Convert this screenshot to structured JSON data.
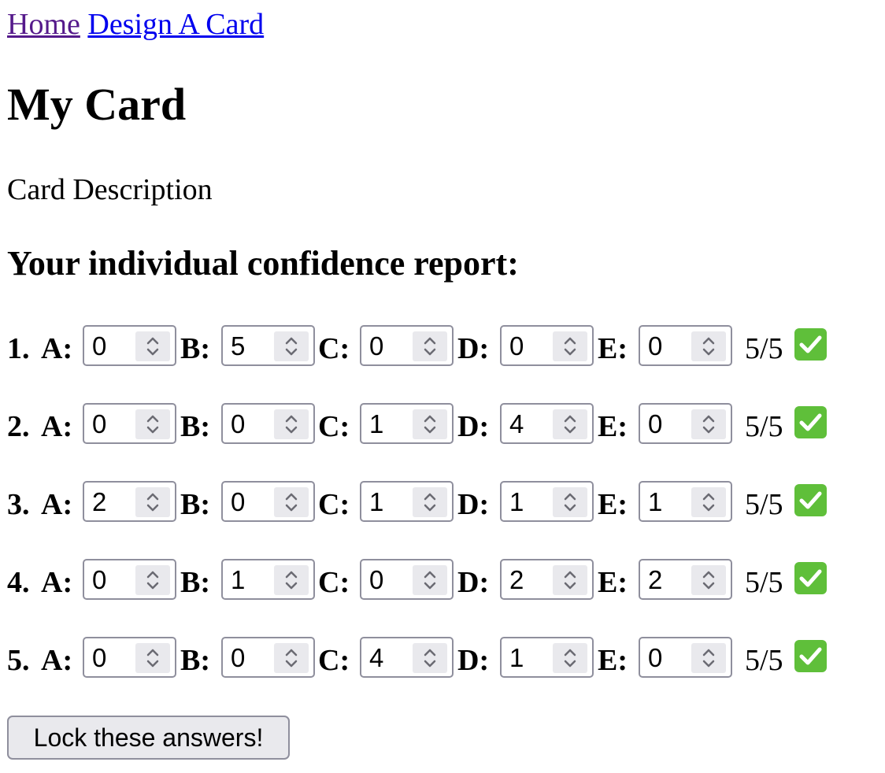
{
  "nav": {
    "links": [
      {
        "label": "Home"
      },
      {
        "label": "Design A Card"
      }
    ]
  },
  "card": {
    "title": "My Card",
    "description": "Card Description"
  },
  "report": {
    "heading": "Your individual confidence report:",
    "option_labels": [
      "A:",
      "B:",
      "C:",
      "D:",
      "E:"
    ],
    "rows": [
      {
        "label": "1.",
        "values": [
          "0",
          "5",
          "0",
          "0",
          "0"
        ],
        "score": "5/5"
      },
      {
        "label": "2.",
        "values": [
          "0",
          "0",
          "1",
          "4",
          "0"
        ],
        "score": "5/5"
      },
      {
        "label": "3.",
        "values": [
          "2",
          "0",
          "1",
          "1",
          "1"
        ],
        "score": "5/5"
      },
      {
        "label": "4.",
        "values": [
          "0",
          "1",
          "0",
          "2",
          "2"
        ],
        "score": "5/5"
      },
      {
        "label": "5.",
        "values": [
          "0",
          "0",
          "4",
          "1",
          "0"
        ],
        "score": "5/5"
      }
    ],
    "status_icon": "check-mark-icon",
    "status_color": "#5fbf3a"
  },
  "actions": {
    "lock_label": "Lock these answers!"
  }
}
